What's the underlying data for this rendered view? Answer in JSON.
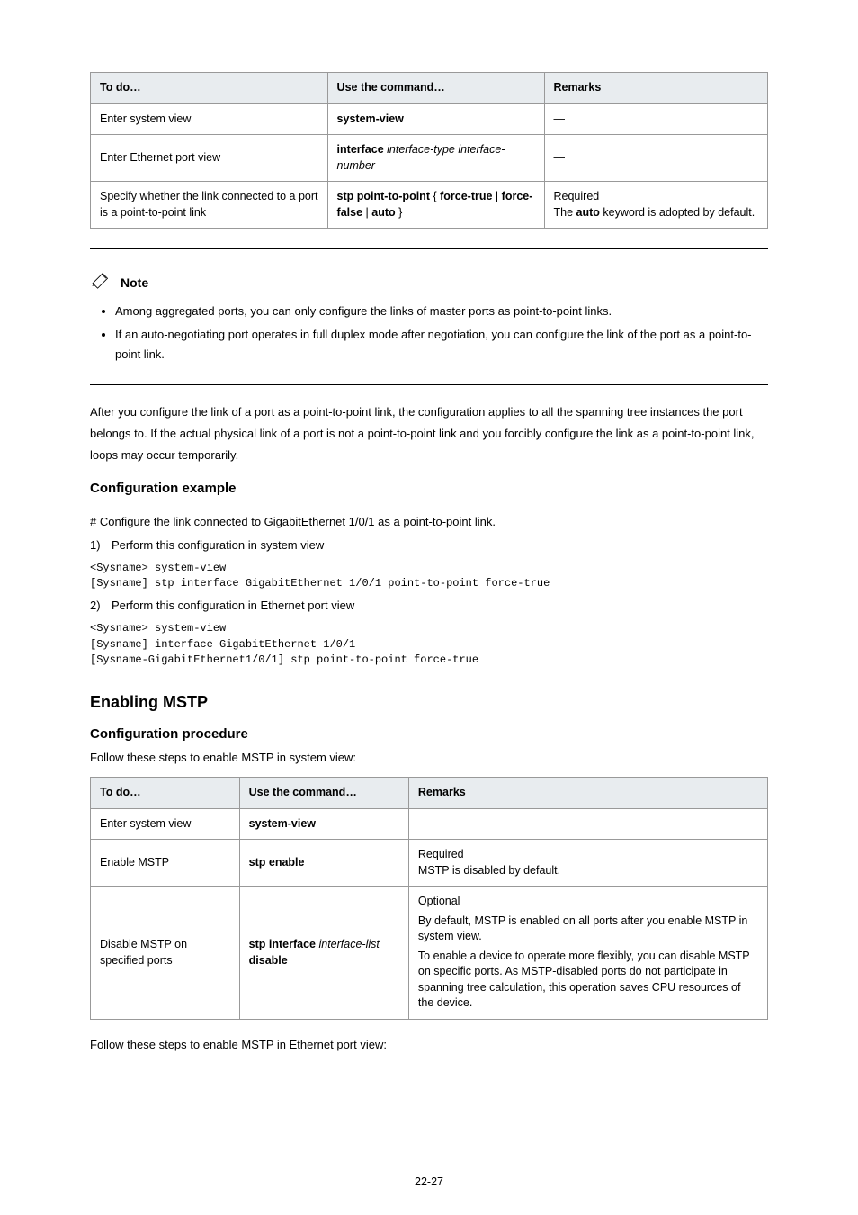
{
  "table1": {
    "headers": [
      "To do…",
      "Use the command…",
      "Remarks"
    ],
    "rows": [
      {
        "c0": "Enter system view",
        "c1": "system-view",
        "c2": "—"
      },
      {
        "c0": "Enter Ethernet port view",
        "c1": "interface interface-type interface-number",
        "c2": "—"
      },
      {
        "c0": "Specify whether the link connected to a port is a point-to-point link",
        "c1a": "stp point-to-point ",
        "c1b": "{ ",
        "c1c": "force-true",
        "c1d": " | ",
        "c1e": "force-false",
        "c1f": " | ",
        "c1g": "auto",
        "c1h": " }",
        "c2a": "Required",
        "c2b": "The ",
        "c2c": "auto",
        "c2d": " keyword is adopted by default."
      }
    ]
  },
  "note_label": "Note",
  "note_items": [
    "Among aggregated ports, you can only configure the links of master ports as point-to-point links.",
    "If an auto-negotiating port operates in full duplex mode after negotiation, you can configure the link of the port as a point-to-point link."
  ],
  "para1": "After you configure the link of a port as a point-to-point link, the configuration applies to all the spanning tree instances the port belongs to. If the actual physical link of a port is not a point-to-point link and you forcibly configure the link as a point-to-point link, loops may occur temporarily.",
  "example_heading": "Configuration example",
  "hash_line": "# Configure the link connected to GigabitEthernet 1/0/1 as a point-to-point link.",
  "step1_num": "1)",
  "step1_text": "Perform this configuration in system view",
  "code1": "<Sysname> system-view\n[Sysname] stp interface GigabitEthernet 1/0/1 point-to-point force-true",
  "step2_num": "2)",
  "step2_text": "Perform this configuration in Ethernet port view",
  "code2": "<Sysname> system-view\n[Sysname] interface GigabitEthernet 1/0/1\n[Sysname-GigabitEthernet1/0/1] stp point-to-point force-true",
  "h2": "Enabling MSTP",
  "h3_1": "Configuration procedure",
  "intro1": "Follow these steps to enable MSTP in system view:",
  "table2": {
    "headers": [
      "To do…",
      "Use the command…",
      "Remarks"
    ],
    "r0": {
      "c0": "Enter system view",
      "c1": "system-view",
      "c2": "—"
    },
    "r1": {
      "c0": "Enable MSTP",
      "c1": "stp enable",
      "c2a": "Required",
      "c2b": "MSTP is disabled by default."
    },
    "r2": {
      "c0": "Disable MSTP on specified ports",
      "c1a": "stp interface",
      "c1b": " interface-list ",
      "c1c": "disable",
      "c2a": "Optional",
      "c2b": "By default, MSTP is enabled on all ports after you enable MSTP in system view.",
      "c2c": "To enable a device to operate more flexibly, you can disable MSTP on specific ports. As MSTP-disabled ports do not participate in spanning tree calculation, this operation saves CPU resources of the device."
    }
  },
  "intro2": "Follow these steps to enable MSTP in Ethernet port view:",
  "page_number": "22-27"
}
